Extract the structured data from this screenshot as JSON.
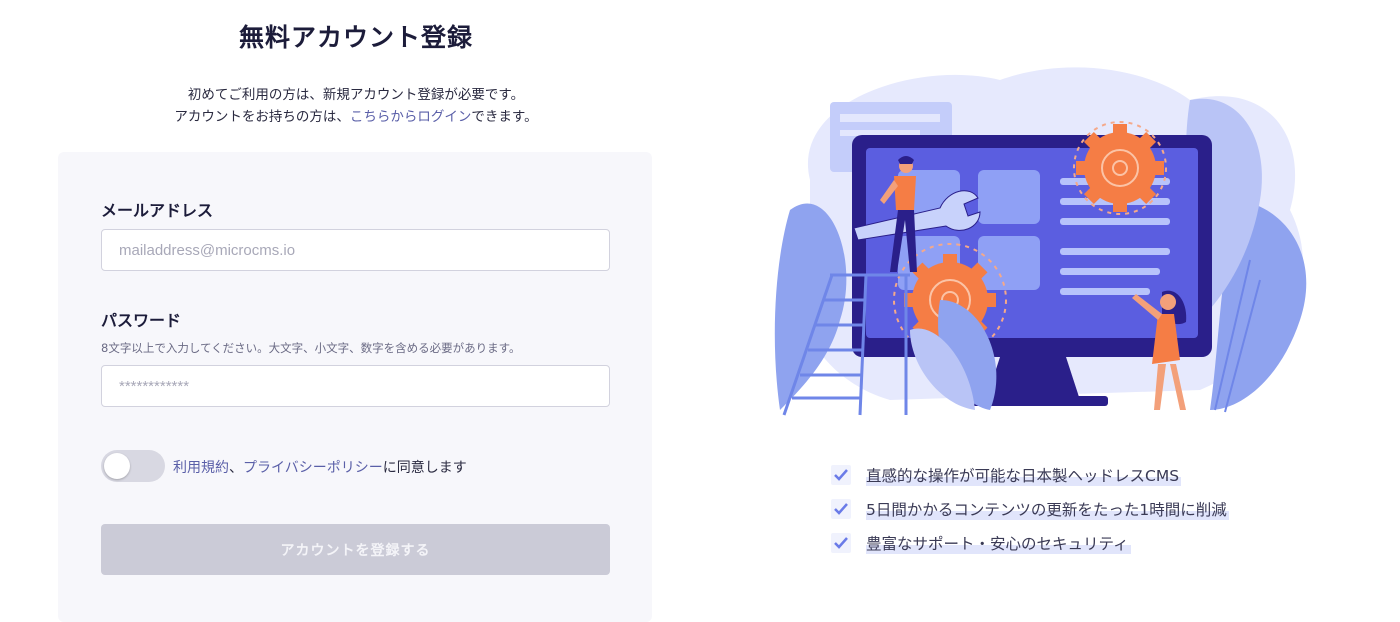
{
  "title": "無料アカウント登録",
  "intro": {
    "line1": "初めてご利用の方は、新規アカウント登録が必要です。",
    "line2_prefix": "アカウントをお持ちの方は、",
    "line2_link": "こちらからログイン",
    "line2_suffix": "できます。"
  },
  "form": {
    "email_label": "メールアドレス",
    "email_placeholder": "mailaddress@microcms.io",
    "password_label": "パスワード",
    "password_hint": "8文字以上で入力してください。大文字、小文字、数字を含める必要があります。",
    "password_placeholder": "************",
    "terms_link": "利用規約",
    "terms_sep": "、",
    "privacy_link": "プライバシーポリシー",
    "agree_suffix": "に同意します",
    "submit_label": "アカウントを登録する"
  },
  "features": [
    "直感的な操作が可能な日本製ヘッドレスCMS",
    "5日間かかるコンテンツの更新をたった1時間に削減",
    "豊富なサポート・安心のセキュリティ"
  ],
  "colors": {
    "accent": "#5a5fa8",
    "monitor_screen": "#5b5ee0",
    "monitor_body": "#2a1f8a",
    "gear": "#f57d45",
    "check": "#6a7be8"
  }
}
